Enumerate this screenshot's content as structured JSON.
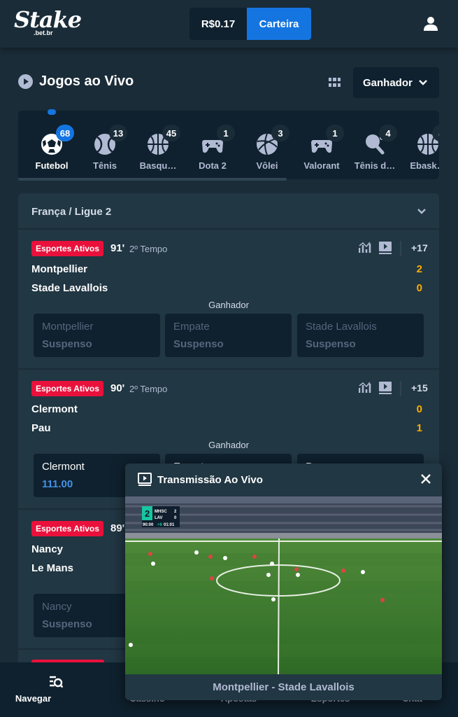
{
  "header": {
    "logo_text": "Stake",
    "logo_domain": ".bet.br",
    "balance": "R$0.17",
    "wallet_label": "Carteira",
    "user_icon": "user-icon"
  },
  "page": {
    "title": "Jogos ao Vivo",
    "market_dropdown": "Ganhador"
  },
  "sports": [
    {
      "label": "Futebol",
      "count": "68",
      "icon": "soccer-ball-icon"
    },
    {
      "label": "Tênis",
      "count": "13",
      "icon": "tennis-ball-icon"
    },
    {
      "label": "Basqu…",
      "count": "45",
      "icon": "basketball-icon"
    },
    {
      "label": "Dota 2",
      "count": "1",
      "icon": "gamepad-icon"
    },
    {
      "label": "Vôlei",
      "count": "3",
      "icon": "volleyball-icon"
    },
    {
      "label": "Valorant",
      "count": "1",
      "icon": "gamepad-icon"
    },
    {
      "label": "Tênis d…",
      "count": "4",
      "icon": "table-tennis-icon"
    },
    {
      "label": "Ebask…",
      "count": "4",
      "icon": "basketball-icon"
    }
  ],
  "league": {
    "name": "França / Ligue 2",
    "matches": [
      {
        "badge": "Esportes Ativos",
        "minute": "91'",
        "period": "2º Tempo",
        "more": "+17",
        "home": "Montpellier",
        "away": "Stade Lavallois",
        "home_score": "2",
        "away_score": "0",
        "market": "Ganhador",
        "odds": [
          {
            "name": "Montpellier",
            "value": "Suspenso"
          },
          {
            "name": "Empate",
            "value": "Suspenso"
          },
          {
            "name": "Stade Lavallois",
            "value": "Suspenso"
          }
        ]
      },
      {
        "badge": "Esportes Ativos",
        "minute": "90'",
        "period": "2º Tempo",
        "more": "+15",
        "home": "Clermont",
        "away": "Pau",
        "home_score": "0",
        "away_score": "1",
        "market": "Ganhador",
        "odds": [
          {
            "name": "Clermont",
            "value": "111.00"
          },
          {
            "name": "Empate",
            "value": ""
          },
          {
            "name": "Pau",
            "value": ""
          }
        ]
      },
      {
        "badge": "Esportes Ativos",
        "minute": "89'",
        "period": "",
        "more": "",
        "home": "Nancy",
        "away": "Le Mans",
        "home_score": "",
        "away_score": "",
        "market": "",
        "odds": [
          {
            "name": "Nancy",
            "value": "Suspenso"
          }
        ]
      }
    ]
  },
  "bottom_nav": [
    {
      "label": "Navegar",
      "icon": "browse-icon"
    },
    {
      "label": "Cassino",
      "icon": "casino-icon"
    },
    {
      "label": "Apostas",
      "icon": "bets-icon"
    },
    {
      "label": "Esportes",
      "icon": "sports-icon"
    },
    {
      "label": "Chat",
      "icon": "chat-icon"
    }
  ],
  "stream": {
    "title": "Transmissão Ao Vivo",
    "match": "Montpellier - Stade Lavallois",
    "scoreboard": {
      "home": "MHSC",
      "home_score": "2",
      "away": "LAV",
      "away_score": "0",
      "clock": "90:00",
      "added": "+6",
      "added_time": "01:01",
      "channel": "2"
    }
  },
  "colors": {
    "background": "#1a2c38",
    "panel": "#213743",
    "dark": "#0f212e",
    "accent": "#1475e1",
    "live": "#e9113c",
    "score": "#fdae00"
  }
}
